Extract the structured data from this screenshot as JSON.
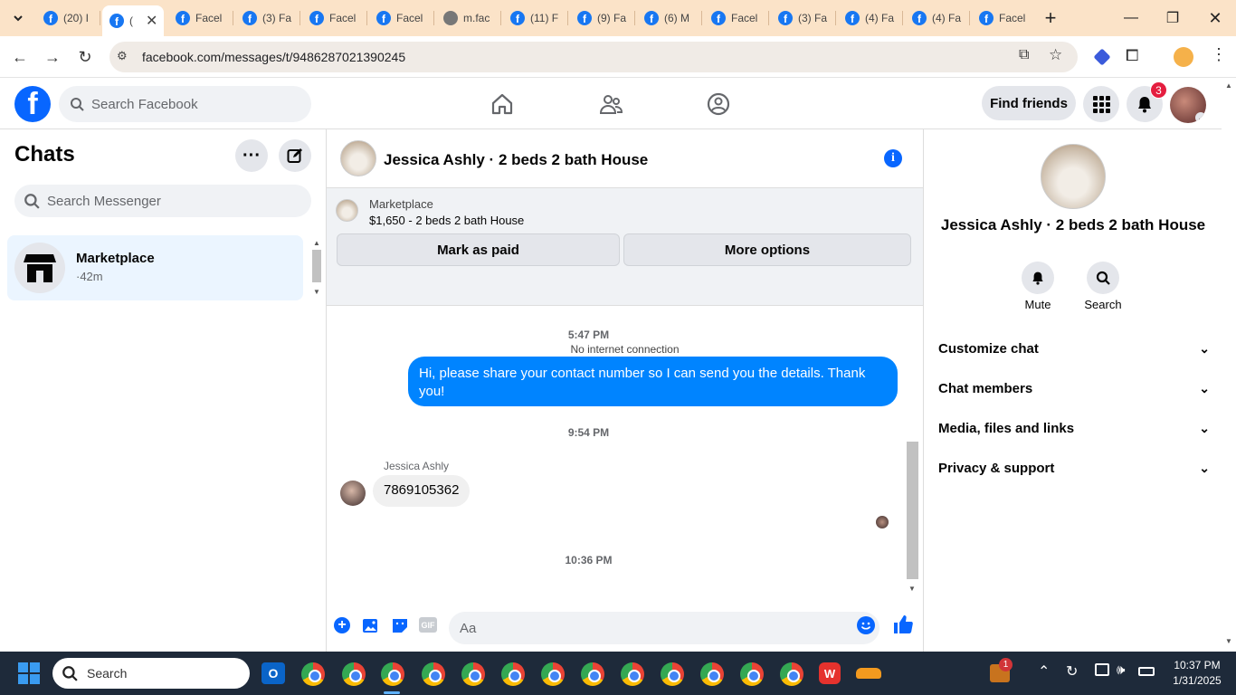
{
  "browser": {
    "tabs": [
      {
        "label": "(20) I",
        "favicon": "facebook-icon"
      },
      {
        "label": "(",
        "favicon": "facebook-icon",
        "active": true
      },
      {
        "label": "Facel",
        "favicon": "facebook-icon"
      },
      {
        "label": "(3) Fa",
        "favicon": "facebook-icon"
      },
      {
        "label": "Facel",
        "favicon": "facebook-icon"
      },
      {
        "label": "Facel",
        "favicon": "facebook-icon"
      },
      {
        "label": "m.fac",
        "favicon": "globe-icon"
      },
      {
        "label": "(11) F",
        "favicon": "facebook-icon"
      },
      {
        "label": "(9) Fa",
        "favicon": "facebook-icon"
      },
      {
        "label": "(6) M",
        "favicon": "facebook-icon"
      },
      {
        "label": "Facel",
        "favicon": "facebook-icon"
      },
      {
        "label": "(3) Fa",
        "favicon": "facebook-icon"
      },
      {
        "label": "(4) Fa",
        "favicon": "facebook-icon"
      },
      {
        "label": "(4) Fa",
        "favicon": "facebook-icon"
      },
      {
        "label": "Facel",
        "favicon": "facebook-icon"
      }
    ],
    "url": "facebook.com/messages/t/9486287021390245"
  },
  "fb": {
    "search_placeholder": "Search Facebook",
    "find_friends": "Find friends",
    "notif_count": "3",
    "brand_color": "#0866ff"
  },
  "chats": {
    "title": "Chats",
    "search_placeholder": "Search Messenger",
    "items": [
      {
        "name": "Marketplace",
        "meta": "·42m"
      }
    ]
  },
  "conversation": {
    "title": "Jessica Ashly · 2 beds 2 bath House",
    "marketplace_label": "Marketplace",
    "listing": "$1,650 - 2 beds 2 bath House",
    "mark_paid": "Mark as paid",
    "more_options": "More options",
    "no_internet": "No internet connection",
    "messages": {
      "ts1": "5:47 PM",
      "out_text": "Hi, please share your contact number so I can send you the details. Thank you!",
      "ts2": "9:54 PM",
      "sender": "Jessica Ashly",
      "in_text": "7869105362",
      "ts3": "10:36 PM"
    },
    "composer_placeholder": "Aa",
    "accent_color": "#0084ff"
  },
  "details": {
    "title": "Jessica Ashly · 2 beds 2 bath House",
    "mute": "Mute",
    "search": "Search",
    "sections": [
      "Customize chat",
      "Chat members",
      "Media, files and links",
      "Privacy & support"
    ]
  },
  "taskbar": {
    "search_placeholder": "Search",
    "time": "10:37 PM",
    "date": "1/31/2025",
    "badge": "1"
  }
}
